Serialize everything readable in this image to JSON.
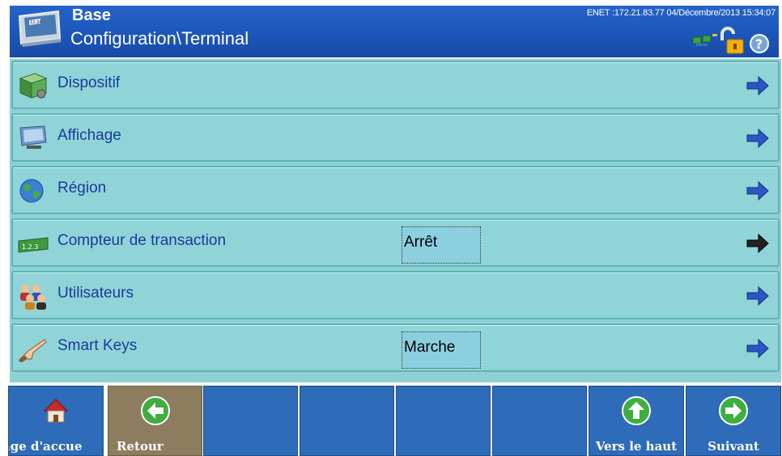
{
  "header": {
    "title": "Base",
    "path": "Configuration\\Terminal",
    "status": "ENET :172.21.83.77  04/Décembre/2013 15:34:07",
    "icons": [
      "network-icon",
      "unlock-icon",
      "help-icon"
    ],
    "icon_screen_text": "12.34"
  },
  "menu": {
    "rows": [
      {
        "label": "Dispositif",
        "value": "",
        "icon": "device-icon",
        "arrow": "blue"
      },
      {
        "label": "Affichage",
        "value": "",
        "icon": "display-icon",
        "arrow": "blue"
      },
      {
        "label": "Région",
        "value": "",
        "icon": "globe-icon",
        "arrow": "blue"
      },
      {
        "label": "Compteur de transaction",
        "value": "Arrêt",
        "icon": "counter-icon",
        "arrow": "black"
      },
      {
        "label": "Utilisateurs",
        "value": "",
        "icon": "users-icon",
        "arrow": "blue"
      },
      {
        "label": "Smart Keys",
        "value": "Marche",
        "icon": "pointer-hand-icon",
        "arrow": "blue"
      }
    ],
    "counter_icon_text": "1.2.3"
  },
  "nav": {
    "buttons": [
      {
        "label": "age d'accue",
        "icon": "home-icon"
      },
      {
        "label": "Retour",
        "icon": "left-arrow-icon"
      },
      {
        "label": "",
        "icon": ""
      },
      {
        "label": "",
        "icon": ""
      },
      {
        "label": "",
        "icon": ""
      },
      {
        "label": "",
        "icon": ""
      },
      {
        "label": "Vers le haut",
        "icon": "up-arrow-icon"
      },
      {
        "label": "Suivant",
        "icon": "right-arrow-icon"
      }
    ]
  },
  "colors": {
    "header_bg": "#1d56bb",
    "row_bg": "#90d4d7",
    "row_text": "#1a3a9c",
    "nav_bg": "#2e6bb8",
    "nav_back_bg": "#8e7c5e",
    "arrow_blue": "#2a56c6",
    "arrow_black": "#222222"
  }
}
